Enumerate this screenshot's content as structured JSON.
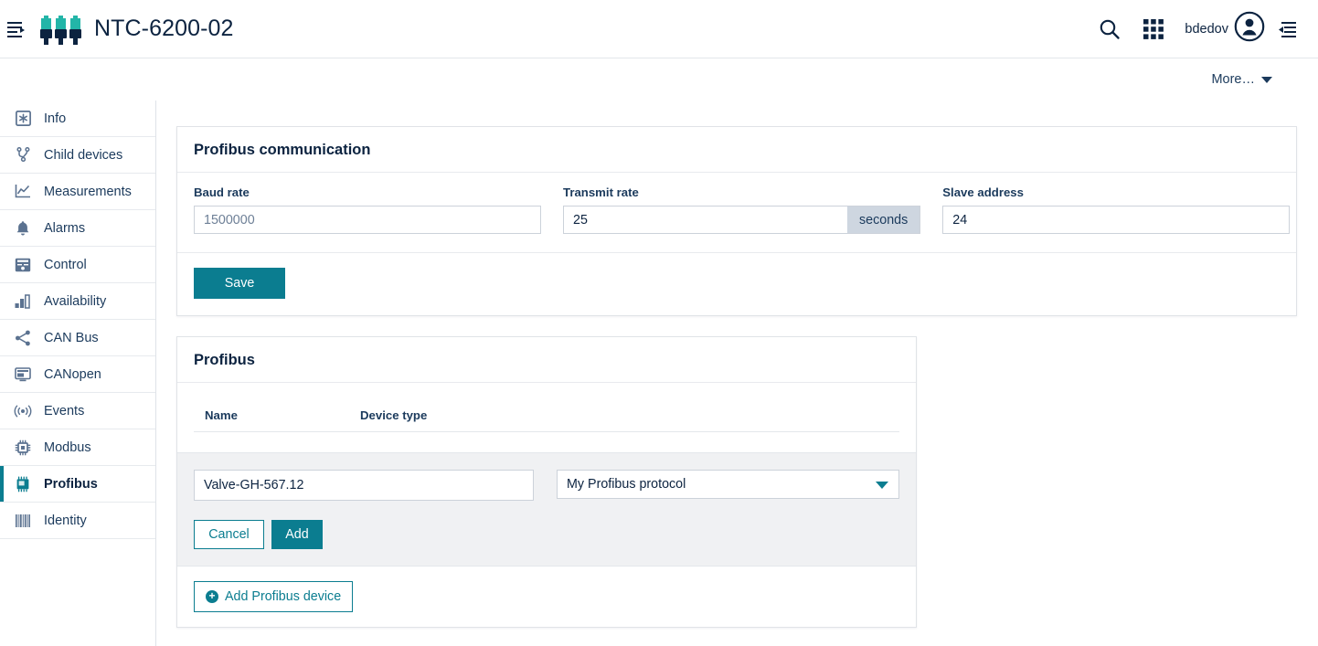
{
  "header": {
    "menu_icon": "menu-collapse-icon",
    "app_title": "NTC-6200-02",
    "search_icon": "search-icon",
    "apps_icon": "apps-grid-icon",
    "username": "bdedov",
    "avatar_icon": "user-avatar-icon",
    "panel_icon": "right-panel-toggle-icon"
  },
  "subbar": {
    "more_label": "More…"
  },
  "sidebar": {
    "items": [
      {
        "label": "Info",
        "icon": "info-asterisk-icon",
        "active": false
      },
      {
        "label": "Child devices",
        "icon": "hierarchy-icon",
        "active": false
      },
      {
        "label": "Measurements",
        "icon": "chart-line-icon",
        "active": false
      },
      {
        "label": "Alarms",
        "icon": "bell-icon",
        "active": false
      },
      {
        "label": "Control",
        "icon": "control-panel-icon",
        "active": false
      },
      {
        "label": "Availability",
        "icon": "bar-chart-icon",
        "active": false
      },
      {
        "label": "CAN Bus",
        "icon": "share-nodes-icon",
        "active": false
      },
      {
        "label": "CANopen",
        "icon": "monitor-icon",
        "active": false
      },
      {
        "label": "Events",
        "icon": "broadcast-icon",
        "active": false
      },
      {
        "label": "Modbus",
        "icon": "chip-icon",
        "active": false
      },
      {
        "label": "Profibus",
        "icon": "chip-board-icon",
        "active": true
      },
      {
        "label": "Identity",
        "icon": "barcode-icon",
        "active": false
      }
    ]
  },
  "communication": {
    "title": "Profibus communication",
    "baud_rate": {
      "label": "Baud rate",
      "value": "1500000"
    },
    "transmit_rate": {
      "label": "Transmit rate",
      "value": "25",
      "suffix": "seconds"
    },
    "slave_address": {
      "label": "Slave address",
      "value": "24"
    },
    "save_label": "Save"
  },
  "profibus": {
    "title": "Profibus",
    "columns": [
      "Name",
      "Device type"
    ],
    "rows": [],
    "edit": {
      "name_value": "Valve-GH-567.12",
      "device_type_value": "My Profibus protocol",
      "cancel_label": "Cancel",
      "add_label": "Add"
    },
    "add_device_label": "Add Profibus device",
    "add_device_icon": "plus-circle-icon"
  },
  "colors": {
    "accent_teal": "#0b7d90",
    "logo_teal": "#23b5a8",
    "navy": "#0c2340",
    "slate": "#5b7290",
    "panel_gray": "#f0f1f3"
  }
}
